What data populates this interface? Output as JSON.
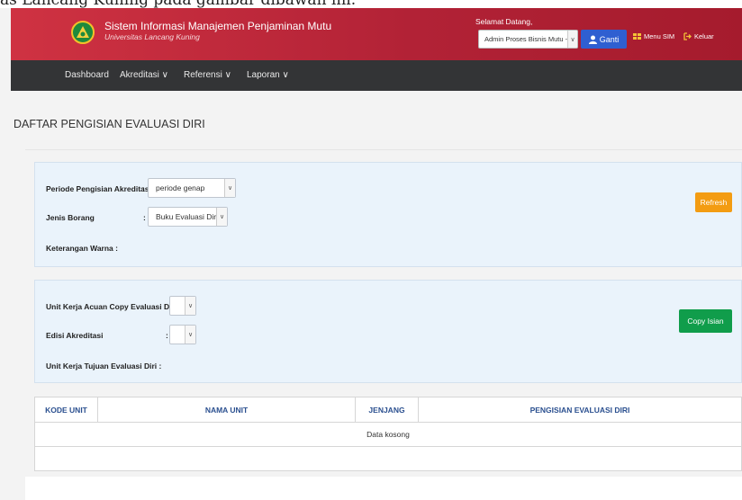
{
  "caption": "as Lancang Kuning pada gambar dibawah ini.",
  "header": {
    "title": "Sistem Informasi Manajemen Penjaminan Mutu",
    "subtitle": "Universitas Lancang Kuning",
    "welcome": "Selamat Datang,",
    "role_value": "Admin Proses Bisnis Mutu - l",
    "ganti_label": "Ganti",
    "menu_sim_label": "Menu SIM",
    "keluar_label": "Keluar"
  },
  "nav": {
    "items": [
      {
        "label": "Dashboard"
      },
      {
        "label": "Akreditasi ∨"
      },
      {
        "label": "Referensi ∨"
      },
      {
        "label": "Laporan ∨"
      }
    ]
  },
  "page": {
    "title": "DAFTAR PENGISIAN EVALUASI DIRI"
  },
  "filter": {
    "periode_label": "Periode Pengisian Akreditasi",
    "periode_value": "periode genap",
    "jenis_label": "Jenis Borang",
    "jenis_value": "Buku Evaluasi Diri",
    "keterangan_label": "Keterangan Warna :",
    "refresh_label": "Refresh"
  },
  "copy": {
    "unit_acuan_label": "Unit Kerja Acuan Copy Evaluasi Diri",
    "unit_acuan_value": "",
    "edisi_label": "Edisi Akreditasi",
    "edisi_value": "",
    "unit_tujuan_label": "Unit Kerja Tujuan Evaluasi Diri :",
    "copy_label": "Copy Isian"
  },
  "table": {
    "columns": [
      "KODE UNIT",
      "NAMA UNIT",
      "JENJANG",
      "PENGISIAN EVALUASI DIRI"
    ],
    "empty_text": "Data kosong"
  },
  "colors": {
    "header_red": "#b22236",
    "nav_dark": "#333436",
    "ganti_blue": "#2f5fd1",
    "refresh_orange": "#f39c12",
    "copy_green": "#109d4b",
    "table_header_text": "#2a4f8f"
  }
}
